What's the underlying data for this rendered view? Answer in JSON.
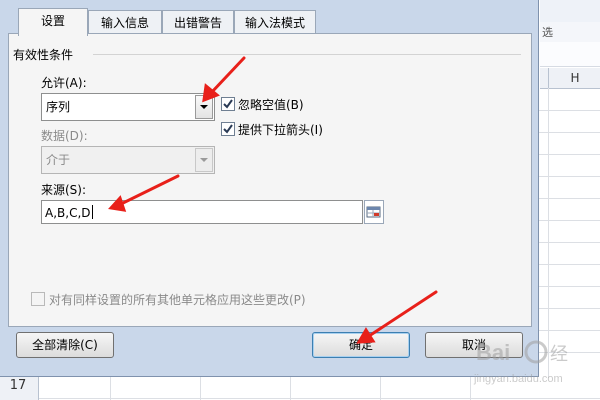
{
  "dialog": {
    "tabs": [
      {
        "label": "设置",
        "active": true
      },
      {
        "label": "输入信息",
        "active": false
      },
      {
        "label": "出错警告",
        "active": false
      },
      {
        "label": "输入法模式",
        "active": false
      }
    ],
    "section_title": "有效性条件",
    "allow": {
      "label": "允许(A):",
      "value": "序列"
    },
    "ignore_blank": {
      "label": "忽略空值(B)",
      "checked": true
    },
    "dropdown": {
      "label": "提供下拉箭头(I)",
      "checked": true
    },
    "data": {
      "label": "数据(D):",
      "value": "介于",
      "disabled": true
    },
    "source": {
      "label": "来源(S):",
      "value": "A,B,C,D"
    },
    "apply_all": {
      "label": "对有同样设置的所有其他单元格应用这些更改(P)",
      "checked": false,
      "disabled": true
    },
    "buttons": {
      "clear_all": "全部清除(C)",
      "ok": "确定",
      "cancel": "取消"
    }
  },
  "sheet": {
    "ribbon_text_1": "选",
    "column_header": "H",
    "row_label": "17"
  },
  "colors": {
    "dialog_frame": "#c9d7ea",
    "panel_bg": "#f5f5f5",
    "arrow_red": "#e8201a",
    "checkbox_check": "#2a3a55"
  }
}
